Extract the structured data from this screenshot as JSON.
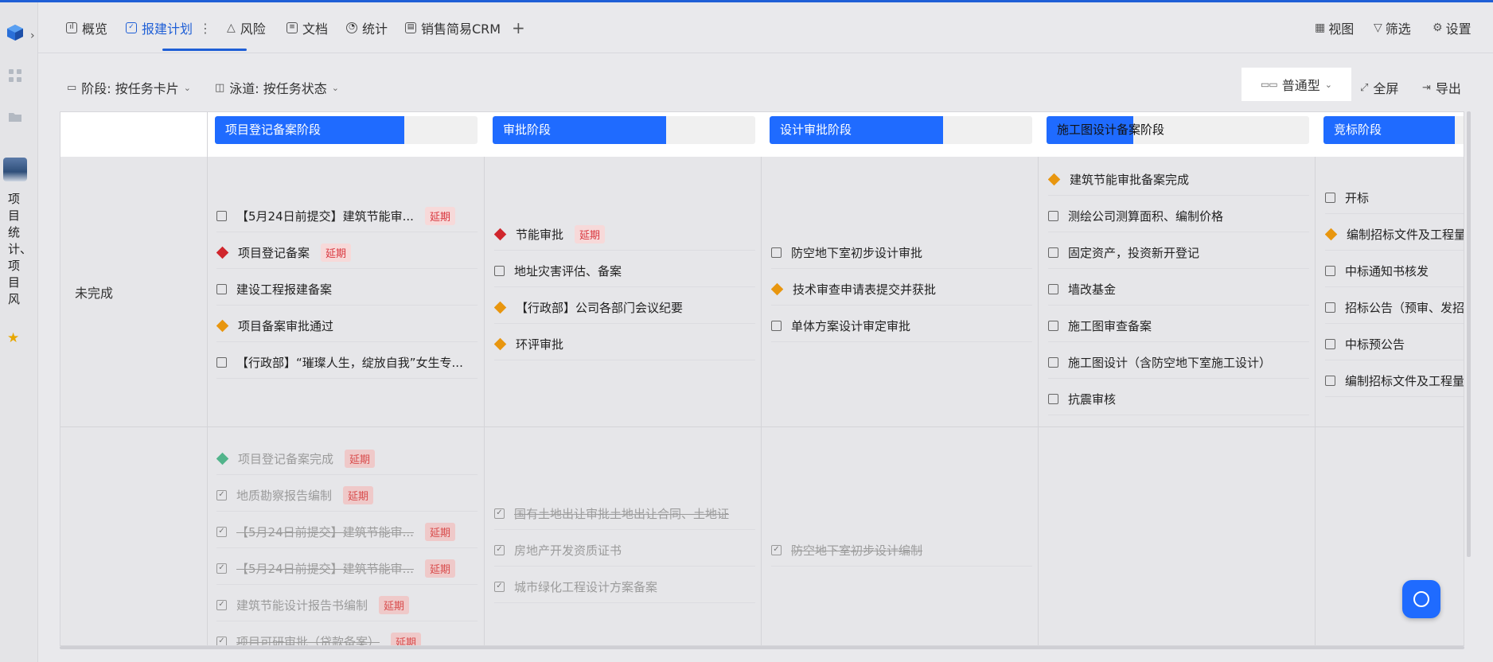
{
  "rail": {
    "vertical_label": "项目统计、项目风"
  },
  "tabs": [
    {
      "label": "概览",
      "icon": "chart-icon"
    },
    {
      "label": "报建计划",
      "icon": "check-square-icon",
      "suffix": "⋮"
    },
    {
      "label": "风险",
      "icon": "warning-icon"
    },
    {
      "label": "文档",
      "icon": "document-icon"
    },
    {
      "label": "统计",
      "icon": "pie-icon"
    },
    {
      "label": "销售简易CRM",
      "icon": "clipboard-icon"
    },
    {
      "label": "+",
      "icon": "plus-icon"
    }
  ],
  "header_right": {
    "view": "视图",
    "filter": "筛选",
    "settings": "设置"
  },
  "toolbar": {
    "stage_group": "阶段: 按任务卡片",
    "lane_group": "泳道: 按任务状态",
    "type": "普通型",
    "fullscreen": "全屏",
    "export": "导出"
  },
  "stages": [
    {
      "label": "项目登记备案阶段",
      "progress": 0.72
    },
    {
      "label": "审批阶段",
      "progress": 0.66
    },
    {
      "label": "设计审批阶段",
      "progress": 0.66
    },
    {
      "label": "施工图设计备案阶段",
      "progress": 0.33
    },
    {
      "label": "竞标阶段",
      "progress": 0.5
    }
  ],
  "lanes": [
    {
      "label": "未完成"
    },
    {
      "label": ""
    }
  ],
  "badge_text": "延期",
  "colors": {
    "accent": "#1f6bff",
    "diamond_red": "#d0262d",
    "diamond_orange": "#e8960f",
    "diamond_green": "#20a36b",
    "badge_bg": "#f7d9d9",
    "badge_fg": "#d9363e"
  },
  "columns": [
    {
      "incomplete": [
        {
          "text": "【5月24日前提交】建筑节能审...",
          "kind": "check",
          "overdue": true
        },
        {
          "text": "项目登记备案",
          "kind": "diamond",
          "color": "red",
          "overdue": true
        },
        {
          "text": "建设工程报建备案",
          "kind": "check",
          "overdue": false
        },
        {
          "text": "项目备案审批通过",
          "kind": "diamond",
          "color": "orange",
          "overdue": false
        },
        {
          "text": "【行政部】“璀璨人生，绽放自我”女生专...",
          "kind": "check",
          "overdue": false
        }
      ],
      "complete": [
        {
          "text": "项目登记备案完成",
          "kind": "diamond",
          "color": "green",
          "overdue": true
        },
        {
          "text": "地质勘察报告编制",
          "kind": "checked",
          "overdue": true
        },
        {
          "text": "【5月24日前提交】建筑节能审...",
          "kind": "checked",
          "overdue": true,
          "strike": true
        },
        {
          "text": "【5月24日前提交】建筑节能审...",
          "kind": "checked",
          "overdue": true,
          "strike": true
        },
        {
          "text": "建筑节能设计报告书编制",
          "kind": "checked",
          "overdue": true
        },
        {
          "text": "项目可研审批（贷款备案）",
          "kind": "checked",
          "overdue": true,
          "strike": true
        }
      ]
    },
    {
      "incomplete": [
        {
          "text": "节能审批",
          "kind": "diamond",
          "color": "red",
          "overdue": true
        },
        {
          "text": "地址灾害评估、备案",
          "kind": "check",
          "overdue": false
        },
        {
          "text": "【行政部】公司各部门会议纪要",
          "kind": "diamond",
          "color": "orange",
          "overdue": false
        },
        {
          "text": "环评审批",
          "kind": "diamond",
          "color": "orange",
          "overdue": false
        }
      ],
      "complete": [
        {
          "text": "国有土地出让审批土地出让合同、土地证",
          "kind": "checked",
          "overdue": false,
          "strike": true
        },
        {
          "text": "房地产开发资质证书",
          "kind": "checked",
          "overdue": false
        },
        {
          "text": "城市绿化工程设计方案备案",
          "kind": "checked",
          "overdue": false
        }
      ]
    },
    {
      "incomplete": [
        {
          "text": "防空地下室初步设计审批",
          "kind": "check",
          "overdue": false
        },
        {
          "text": "技术审查申请表提交并获批",
          "kind": "diamond",
          "color": "orange",
          "overdue": false
        },
        {
          "text": "单体方案设计审定审批",
          "kind": "check",
          "overdue": false
        }
      ],
      "complete": [
        {
          "text": "防空地下室初步设计编制",
          "kind": "checked",
          "overdue": false,
          "strike": true
        }
      ]
    },
    {
      "incomplete": [
        {
          "text": "建筑节能审批备案完成",
          "kind": "diamond",
          "color": "orange",
          "overdue": false
        },
        {
          "text": "测绘公司测算面积、编制价格",
          "kind": "check",
          "overdue": false
        },
        {
          "text": "固定资产，投资新开登记",
          "kind": "check",
          "overdue": false
        },
        {
          "text": "墙改基金",
          "kind": "check",
          "overdue": false
        },
        {
          "text": "施工图审查备案",
          "kind": "check",
          "overdue": false
        },
        {
          "text": "施工图设计（含防空地下室施工设计）",
          "kind": "check",
          "overdue": false
        },
        {
          "text": "抗震审核",
          "kind": "check",
          "overdue": false
        }
      ],
      "complete": []
    },
    {
      "incomplete": [
        {
          "text": "开标",
          "kind": "check",
          "overdue": false
        },
        {
          "text": "编制招标文件及工程量",
          "kind": "diamond",
          "color": "orange",
          "overdue": false
        },
        {
          "text": "中标通知书核发",
          "kind": "check",
          "overdue": false
        },
        {
          "text": "招标公告（预审、发招",
          "kind": "check",
          "overdue": false
        },
        {
          "text": "中标预公告",
          "kind": "check",
          "overdue": false
        },
        {
          "text": "编制招标文件及工程量",
          "kind": "check",
          "overdue": false
        }
      ],
      "complete": []
    }
  ]
}
